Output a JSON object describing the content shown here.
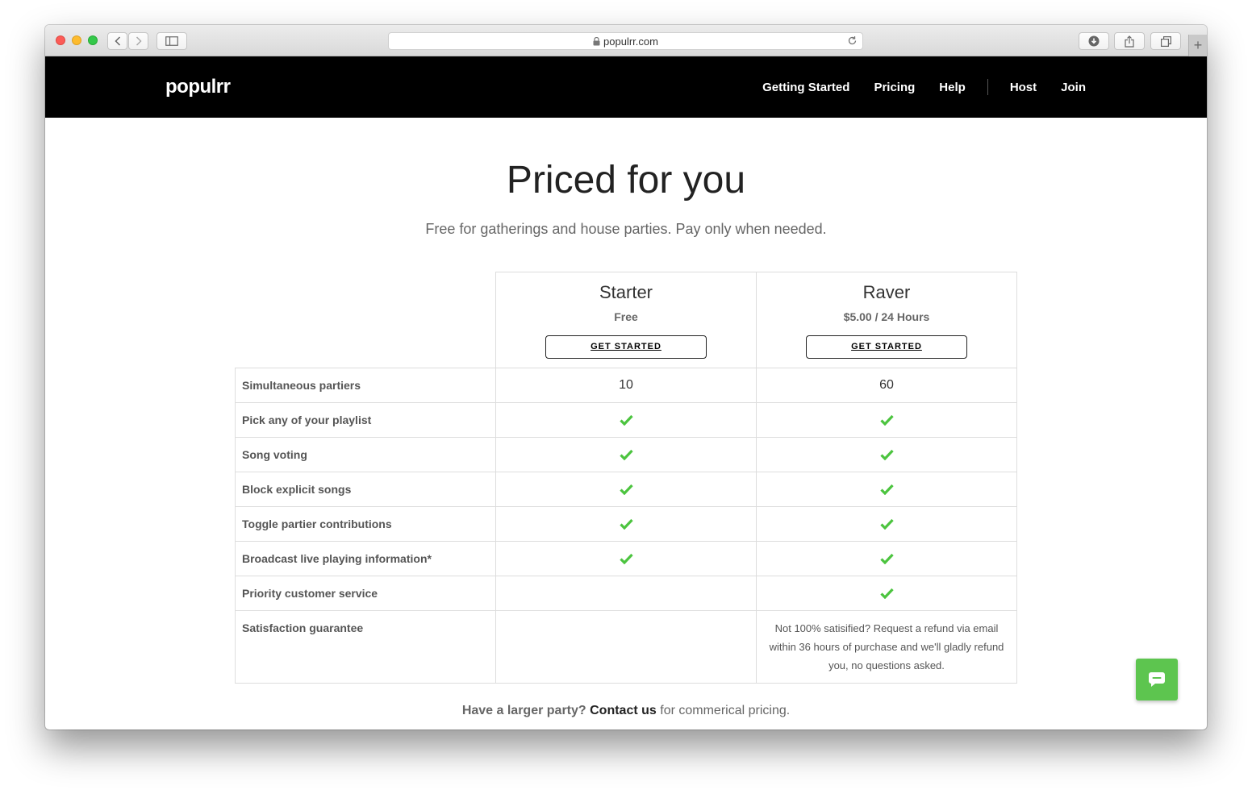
{
  "browser": {
    "url": "populrr.com",
    "icons": {
      "back": "chevron-left-icon",
      "forward": "chevron-right-icon",
      "sidebar": "sidebar-icon",
      "lock": "lock-icon",
      "reload": "reload-icon",
      "downloads": "download-icon",
      "share": "share-icon",
      "tabs": "tabs-icon",
      "new_tab": "plus-icon"
    },
    "new_tab_label": "+"
  },
  "navbar": {
    "logo": "populrr",
    "links": [
      "Getting Started",
      "Pricing",
      "Help",
      "Host",
      "Join"
    ]
  },
  "hero": {
    "title": "Priced for you",
    "subtitle": "Free for gatherings and house parties. Pay only when needed."
  },
  "plans": [
    {
      "name": "Starter",
      "price": "Free",
      "cta": "GET STARTED"
    },
    {
      "name": "Raver",
      "price": "$5.00 / 24 Hours",
      "cta": "GET STARTED"
    }
  ],
  "features": [
    {
      "label": "Simultaneous partiers",
      "starter": "10",
      "raver": "60"
    },
    {
      "label": "Pick any of your playlist",
      "starter": "check",
      "raver": "check"
    },
    {
      "label": "Song voting",
      "starter": "check",
      "raver": "check"
    },
    {
      "label": "Block explicit songs",
      "starter": "check",
      "raver": "check"
    },
    {
      "label": "Toggle partier contributions",
      "starter": "check",
      "raver": "check"
    },
    {
      "label": "Broadcast live playing information*",
      "starter": "check",
      "raver": "check"
    },
    {
      "label": "Priority customer service",
      "starter": "",
      "raver": "check"
    },
    {
      "label": "Satisfaction guarantee",
      "starter": "",
      "raver": "Not 100% satisified? Request a refund via email within 36 hours of purchase and we'll gladly refund you, no questions asked."
    }
  ],
  "footer": {
    "lead": "Have a larger party?",
    "link": "Contact us",
    "tail": "for commerical pricing."
  },
  "colors": {
    "check": "#4cc43f",
    "chat_button": "#5dc54f",
    "navbar": "#000000"
  },
  "chat": {
    "icon": "chat-bubble-icon"
  }
}
